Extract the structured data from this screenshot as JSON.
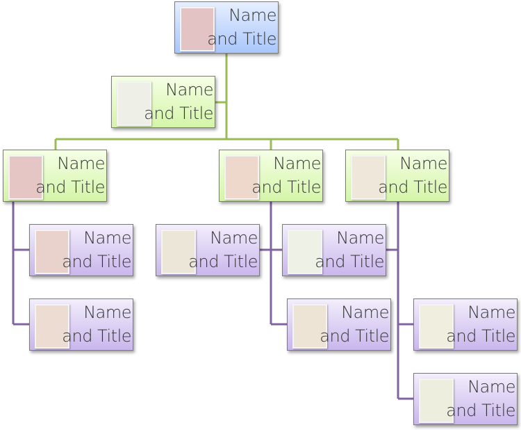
{
  "colors": {
    "top": "#a9c6fb",
    "level2": "#d4f5a8",
    "level3": "#c9b6ec",
    "green_line": "#9bbb59",
    "purple_line": "#8064a2"
  },
  "nodes": [
    {
      "id": "top",
      "line1": "Name",
      "line2": "and Title",
      "photo": "#e3c3c3",
      "level": "blue"
    },
    {
      "id": "assistant",
      "line1": "Name",
      "line2": "and Title",
      "photo": "#eef0e8",
      "level": "green"
    },
    {
      "id": "manager-1",
      "line1": "Name",
      "line2": "and Title",
      "photo": "#e6c6c4",
      "level": "green"
    },
    {
      "id": "manager-2",
      "line1": "Name",
      "line2": "and Title",
      "photo": "#eed8cc",
      "level": "green"
    },
    {
      "id": "manager-3",
      "line1": "Name",
      "line2": "and Title",
      "photo": "#efe8da",
      "level": "green"
    },
    {
      "id": "staff-1a",
      "line1": "Name",
      "line2": "and Title",
      "photo": "#e9d2cb",
      "level": "purple"
    },
    {
      "id": "staff-1b",
      "line1": "Name",
      "line2": "and Title",
      "photo": "#ecdcd2",
      "level": "purple"
    },
    {
      "id": "staff-2-assist",
      "line1": "Name",
      "line2": "and Title",
      "photo": "#ebe6d8",
      "level": "purple"
    },
    {
      "id": "staff-2a",
      "line1": "Name",
      "line2": "and Title",
      "photo": "#eef1e5",
      "level": "purple"
    },
    {
      "id": "staff-2b",
      "line1": "Name",
      "line2": "and Title",
      "photo": "#ede4d6",
      "level": "purple"
    },
    {
      "id": "staff-3a",
      "line1": "Name",
      "line2": "and Title",
      "photo": "#efeedf",
      "level": "purple"
    },
    {
      "id": "staff-3b",
      "line1": "Name",
      "line2": "and Title",
      "photo": "#eeeedf",
      "level": "purple"
    }
  ]
}
